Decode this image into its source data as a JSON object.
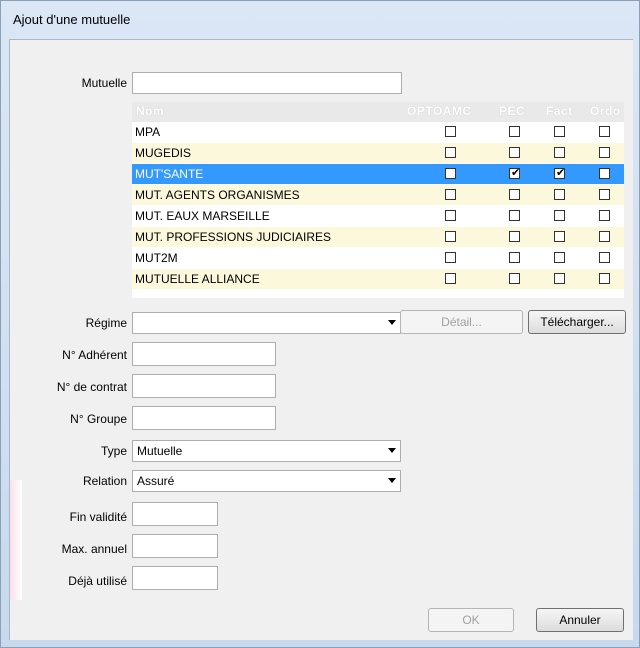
{
  "window": {
    "title": "Ajout d'une mutuelle"
  },
  "labels": {
    "mutuelle": "Mutuelle",
    "regime": "Régime",
    "adherent": "N° Adhérent",
    "contrat": "N° de contrat",
    "groupe": "N° Groupe",
    "type": "Type",
    "relation": "Relation",
    "fin_validite": "Fin validité",
    "max_annuel": "Max. annuel",
    "deja_utilise": "Déjà utilisé"
  },
  "fields": {
    "mutuelle": "",
    "regime": "",
    "adherent": "",
    "contrat": "",
    "groupe": "",
    "type": "Mutuelle",
    "relation": "Assuré",
    "fin_validite": "",
    "max_annuel": "",
    "deja_utilise": ""
  },
  "grid": {
    "headers": [
      "Nom",
      "OPTOAMC",
      "PEC",
      "Fact",
      "Ordo"
    ],
    "rows": [
      {
        "name": "MPA",
        "opto": false,
        "pec": false,
        "fact": false,
        "ordo": false
      },
      {
        "name": "MUGEDIS",
        "opto": false,
        "pec": false,
        "fact": false,
        "ordo": false
      },
      {
        "name": "MUT'SANTE",
        "opto": false,
        "pec": true,
        "fact": true,
        "ordo": false,
        "selected": true
      },
      {
        "name": "MUT. AGENTS ORGANISMES",
        "opto": false,
        "pec": false,
        "fact": false,
        "ordo": false
      },
      {
        "name": "MUT. EAUX MARSEILLE",
        "opto": false,
        "pec": false,
        "fact": false,
        "ordo": false
      },
      {
        "name": "MUT. PROFESSIONS JUDICIAIRES",
        "opto": false,
        "pec": false,
        "fact": false,
        "ordo": false
      },
      {
        "name": "MUT2M",
        "opto": false,
        "pec": false,
        "fact": false,
        "ordo": false
      },
      {
        "name": "MUTUELLE ALLIANCE",
        "opto": false,
        "pec": false,
        "fact": false,
        "ordo": false
      }
    ],
    "colors": {
      "odd": "#ffffff",
      "even": "#fbf8dc",
      "selected": "#3399ff"
    }
  },
  "buttons": {
    "detail": "Détail...",
    "telecharger": "Télécharger...",
    "ok": "OK",
    "annuler": "Annuler"
  }
}
